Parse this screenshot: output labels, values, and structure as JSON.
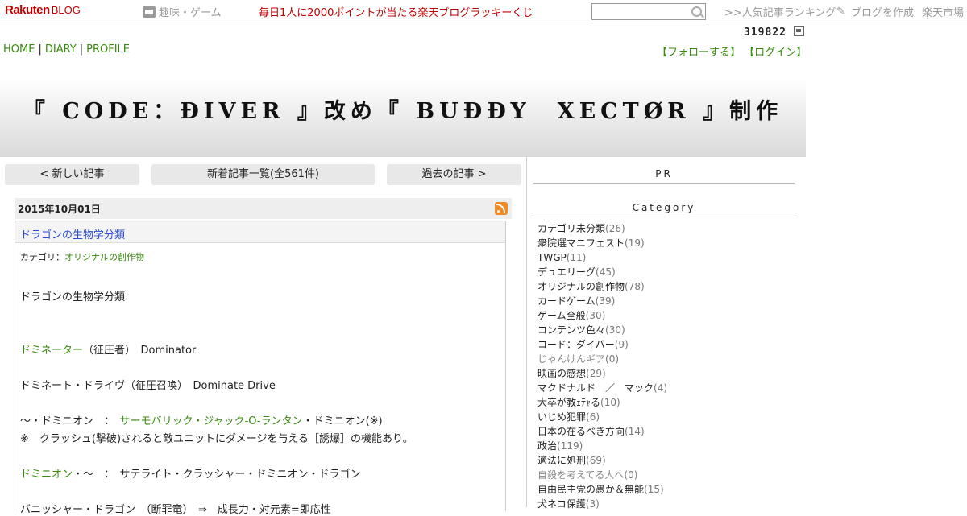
{
  "topbar": {
    "logo_main": "Rakuten",
    "logo_sub": "BLOG",
    "genre": "趣味・ゲーム",
    "lucky": "毎日1人に2000ポイントが当たる楽天ブログラッキーくじ",
    "ranking": ">>人気記事ランキング",
    "create": "ブログを作成",
    "market": "楽天市場",
    "search_value": ""
  },
  "counter": "319822",
  "nav": {
    "home": "HOME",
    "diary": "DIARY",
    "profile": "PROFILE",
    "sep": "|"
  },
  "userlinks": {
    "follow": "【フォローする】",
    "login": "【ログイン】"
  },
  "blog_title": "『 CODE：ÐIVER 』改め『 BUÐÐY　XECTØR 』制作",
  "pager": {
    "newer": "< 新しい記事",
    "list": "新着記事一覧(全561件)",
    "older": "過去の記事 >"
  },
  "article": {
    "date": "2015年10月01日",
    "title": "ドラゴンの生物学分類",
    "category_label": "カテゴリ：",
    "category": "オリジナルの創作物",
    "heading": "ドラゴンの生物学分類",
    "l1_green": "ドミネーター",
    "l1_rest": "（征圧者）　Dominator",
    "l2": "ドミネート・ドライヴ（征圧召喚）　Dominate Drive",
    "l3_a": "～・ドミニオン　：　",
    "l3_green": "サーモバリック・ジャック-O-ランタン",
    "l3_b": "・ドミニオン(※)",
    "l4": "※　クラッシュ(撃破)されると敵ユニットにダメージを与える［誘爆］の機能あり。",
    "l5_green": "ドミニオン",
    "l5_rest": "・～　：　サテライト・クラッシャー・ドミニオン・ドラゴン",
    "l6": "バニッシャー・ドラゴン　（断罪竜）　⇒　成長力・対元素=即応性"
  },
  "sidebar": {
    "pr": "PR",
    "category_heading": "Category",
    "categories": [
      {
        "name": "カテゴリ未分類",
        "count": "(26)"
      },
      {
        "name": "衆院選マニフェスト",
        "count": "(19)"
      },
      {
        "name": "TWGP",
        "count": "(11)"
      },
      {
        "name": "デュエリーグ",
        "count": "(45)"
      },
      {
        "name": "オリジナルの創作物",
        "count": "(78)"
      },
      {
        "name": "カードゲーム",
        "count": "(39)"
      },
      {
        "name": "ゲーム全般",
        "count": "(30)"
      },
      {
        "name": "コンテンツ色々",
        "count": "(30)"
      },
      {
        "name": "コード：ダイバー",
        "count": "(9)"
      },
      {
        "name": "じゃんけんギア",
        "count": "(0)"
      },
      {
        "name": "映画の感想",
        "count": "(29)"
      },
      {
        "name": "マクドナルド　／　マック",
        "count": "(4)"
      },
      {
        "name": "大卒が教ｪﾃｬる",
        "count": "(10)"
      },
      {
        "name": "いじめ犯罪",
        "count": "(6)"
      },
      {
        "name": "日本の在るべき方向",
        "count": "(14)"
      },
      {
        "name": "政治",
        "count": "(119)"
      },
      {
        "name": "適法に処刑",
        "count": "(69)"
      },
      {
        "name": "自殺を考えてる人へ",
        "count": "(0)"
      },
      {
        "name": "自由民主党の愚か＆無能",
        "count": "(15)"
      },
      {
        "name": "犬ネコ保護",
        "count": "(3)"
      }
    ]
  }
}
